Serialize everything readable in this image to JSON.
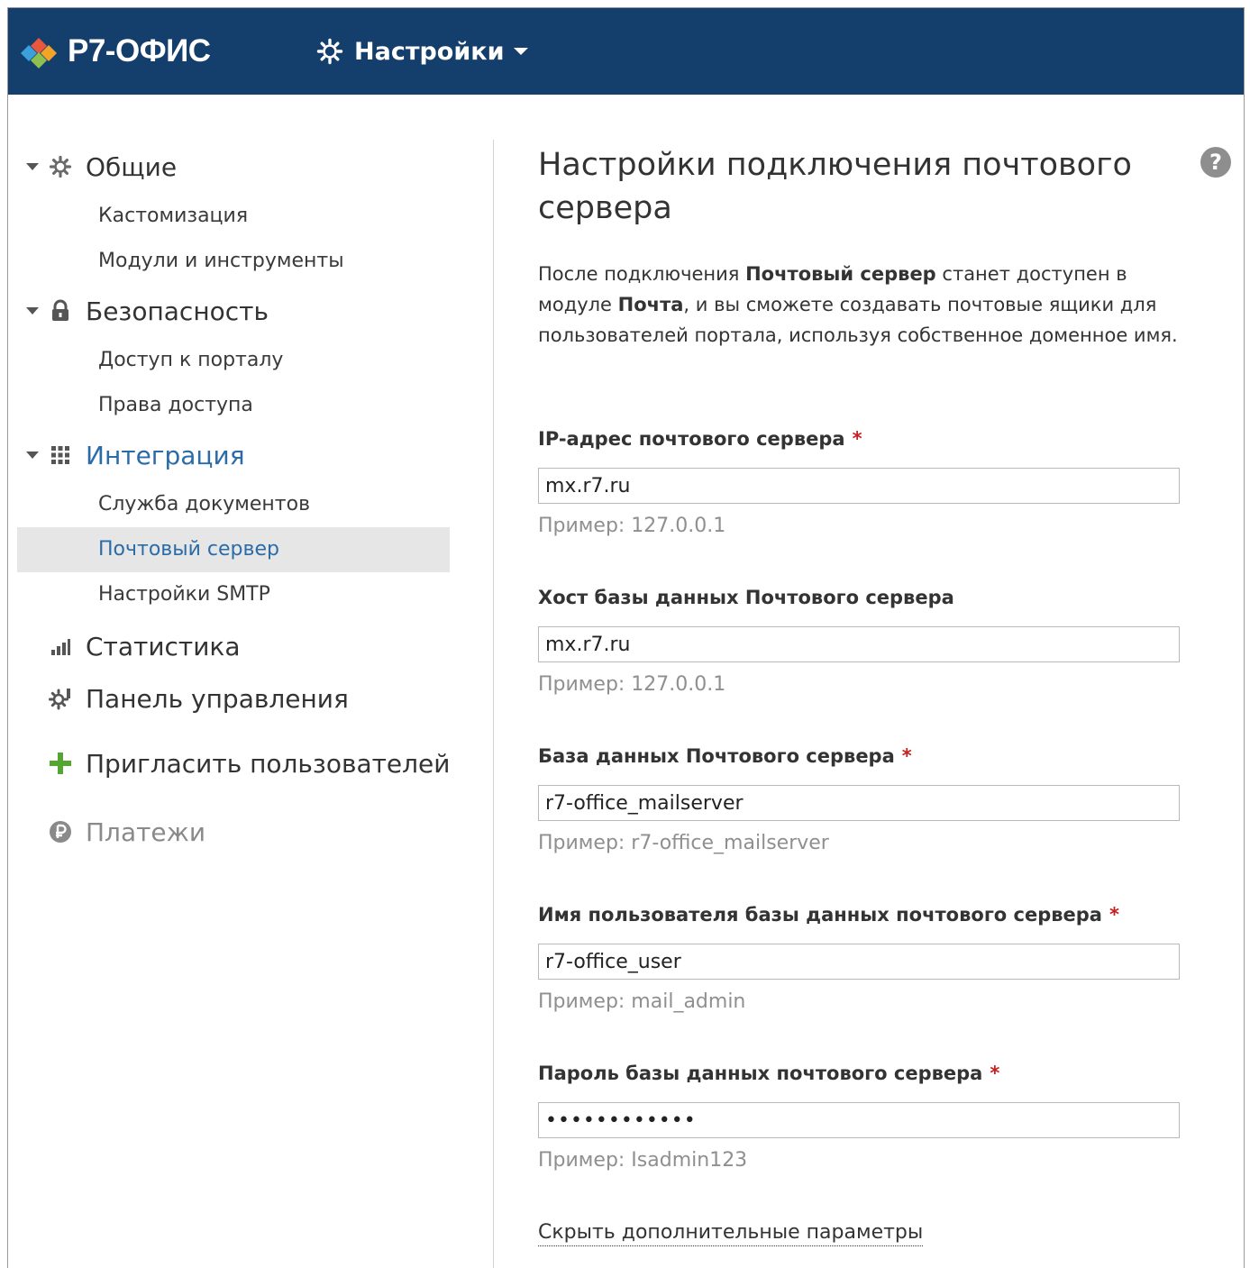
{
  "header": {
    "logo_text": "Р7-ОФИС",
    "menu_label": "Настройки"
  },
  "sidebar": {
    "groups": [
      {
        "label": "Общие",
        "icon": "gear-icon",
        "items": [
          {
            "label": "Кастомизация"
          },
          {
            "label": "Модули и инструменты"
          }
        ]
      },
      {
        "label": "Безопасность",
        "icon": "lock-icon",
        "items": [
          {
            "label": "Доступ к порталу"
          },
          {
            "label": "Права доступа"
          }
        ]
      },
      {
        "label": "Интеграция",
        "icon": "grid-icon",
        "items": [
          {
            "label": "Служба документов"
          },
          {
            "label": "Почтовый сервер",
            "active": true
          },
          {
            "label": "Настройки SMTP"
          }
        ]
      },
      {
        "label": "Статистика",
        "icon": "bar-chart-icon"
      },
      {
        "label": "Панель управления",
        "icon": "control-panel-icon"
      },
      {
        "label": "Пригласить пользователей",
        "icon": "plus-icon"
      },
      {
        "label": "Платежи",
        "icon": "ruble-icon"
      }
    ]
  },
  "main": {
    "title": "Настройки подключения почтового сервера",
    "help_label": "?",
    "description": {
      "part1": "После подключения ",
      "bold1": "Почтовый сервер",
      "part2": " станет доступен в модуле ",
      "bold2": "Почта",
      "part3": ", и вы сможете создавать почтовые ящики для пользователей портала, используя собственное доменное имя."
    },
    "fields": [
      {
        "label": "IP-адрес почтового сервера",
        "required": true,
        "value": "mx.r7.ru",
        "hint": "Пример: 127.0.0.1"
      },
      {
        "label": "Хост базы данных Почтового сервера",
        "required": false,
        "value": "mx.r7.ru",
        "hint": "Пример: 127.0.0.1"
      },
      {
        "label": "База данных Почтового сервера",
        "required": true,
        "value": "r7-office_mailserver",
        "hint": "Пример: r7-office_mailserver"
      },
      {
        "label": "Имя пользователя базы данных почтового сервера",
        "required": true,
        "value": "r7-office_user",
        "hint": "Пример: mail_admin"
      },
      {
        "label": "Пароль базы данных почтового сервера",
        "required": true,
        "value": "••••••••••••",
        "hint": "Пример: Isadmin123"
      }
    ],
    "required_mark": "*",
    "more_link": "Скрыть дополнительные параметры"
  },
  "colors": {
    "header_bg": "#143e6b",
    "link_blue": "#2b6ca8",
    "required_red": "#c81e1e",
    "active_item_bg": "#e6e6e6"
  }
}
